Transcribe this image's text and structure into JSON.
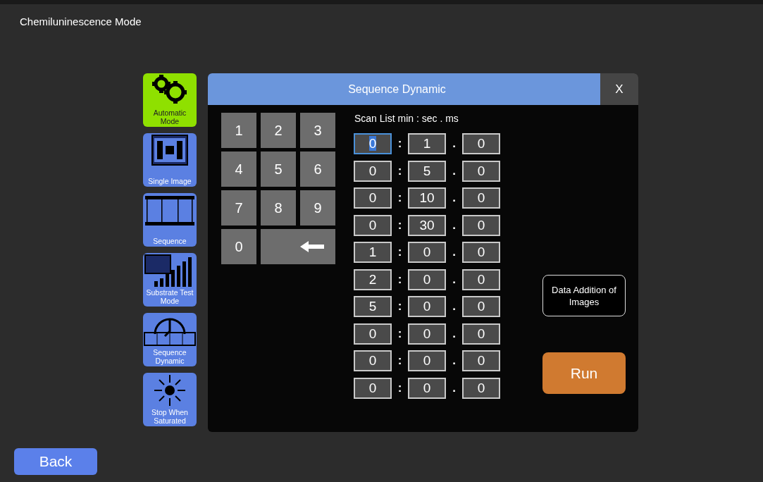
{
  "window": {
    "title": "Chemiluninescence Mode"
  },
  "sidebar": {
    "items": [
      {
        "label": "Automatic Mode",
        "selected": true
      },
      {
        "label": "Single Image",
        "selected": false
      },
      {
        "label": "Sequence",
        "selected": false
      },
      {
        "label": "Substrate Test Mode",
        "selected": false
      },
      {
        "label": "Sequence Dynamic",
        "selected": false
      },
      {
        "label": "Stop When Saturated",
        "selected": false
      }
    ]
  },
  "dialog": {
    "title": "Sequence Dynamic",
    "close": "X",
    "keypad": [
      {
        "kind": "digit",
        "label": "1"
      },
      {
        "kind": "digit",
        "label": "2"
      },
      {
        "kind": "digit",
        "label": "3"
      },
      {
        "kind": "digit",
        "label": "4"
      },
      {
        "kind": "digit",
        "label": "5"
      },
      {
        "kind": "digit",
        "label": "6"
      },
      {
        "kind": "digit",
        "label": "7"
      },
      {
        "kind": "digit",
        "label": "8"
      },
      {
        "kind": "digit",
        "label": "9"
      },
      {
        "kind": "digit",
        "label": "0"
      },
      {
        "kind": "backspace"
      }
    ],
    "scan_list_label": "Scan List  min : sec . ms",
    "rows": [
      {
        "min": "0",
        "sec": "1",
        "ms": "0",
        "focused": true
      },
      {
        "min": "0",
        "sec": "5",
        "ms": "0",
        "focused": false
      },
      {
        "min": "0",
        "sec": "10",
        "ms": "0",
        "focused": false
      },
      {
        "min": "0",
        "sec": "30",
        "ms": "0",
        "focused": false
      },
      {
        "min": "1",
        "sec": "0",
        "ms": "0",
        "focused": false
      },
      {
        "min": "2",
        "sec": "0",
        "ms": "0",
        "focused": false
      },
      {
        "min": "5",
        "sec": "0",
        "ms": "0",
        "focused": false
      },
      {
        "min": "0",
        "sec": "0",
        "ms": "0",
        "focused": false
      },
      {
        "min": "0",
        "sec": "0",
        "ms": "0",
        "focused": false
      },
      {
        "min": "0",
        "sec": "0",
        "ms": "0",
        "focused": false
      }
    ],
    "separators": [
      ":",
      "."
    ],
    "data_addition_button": "Data Addition of Images",
    "run_button": "Run"
  },
  "back_button": "Back"
}
